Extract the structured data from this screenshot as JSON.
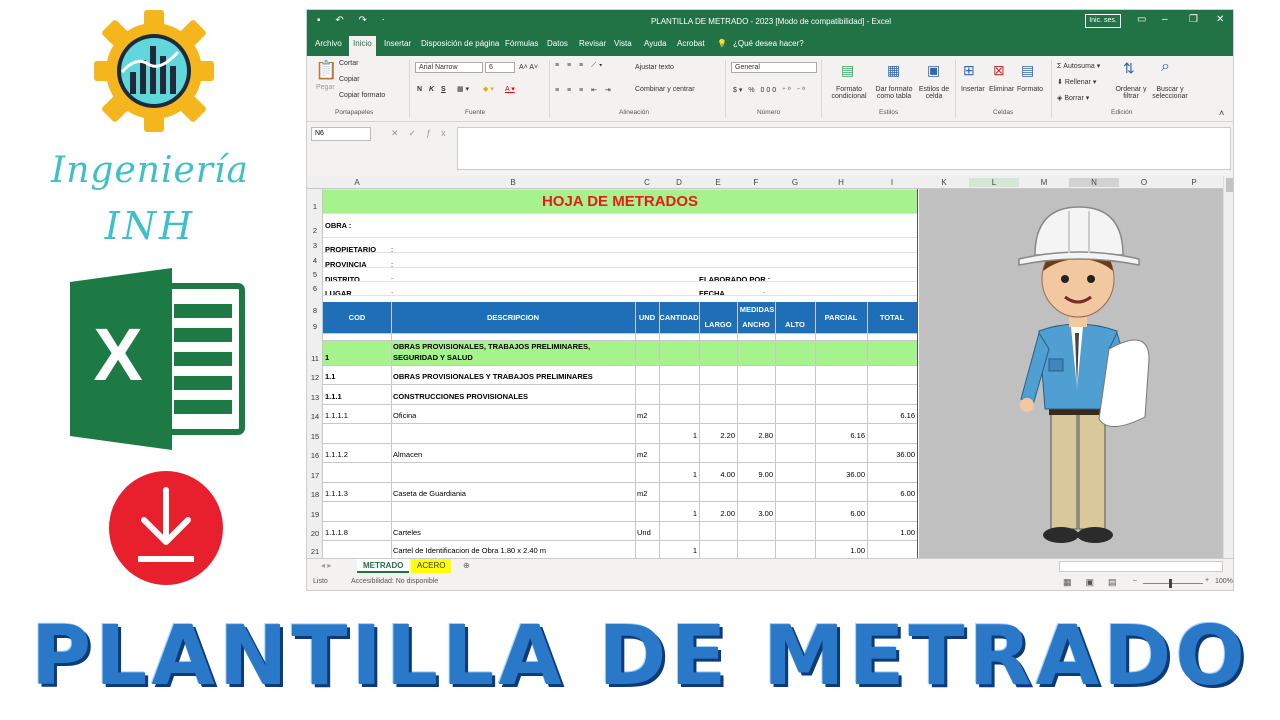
{
  "brand": {
    "line1": "Ingeniería",
    "line2": "INH",
    "gear_color": "#f5b61d",
    "accent": "#3fc0c8",
    "download_color": "#e8202e"
  },
  "banner": {
    "text": "PLANTILLA DE METRADO",
    "color": "#2a78c8"
  },
  "excel": {
    "title": "PLANTILLA DE METRADO - 2023  [Modo de compatibilidad]  -  Excel",
    "login_label": "Inic. ses.",
    "quick_access": "▪ ↶ ↷ ⋅",
    "tabs": [
      "Archivo",
      "Inicio",
      "Insertar",
      "Disposición de página",
      "Fórmulas",
      "Datos",
      "Revisar",
      "Vista",
      "Ayuda",
      "Acrobat"
    ],
    "active_tab": "Inicio",
    "tell_me": "¿Qué desea hacer?",
    "ribbon": {
      "cut": "Cortar",
      "copy": "Copiar",
      "format_painter": "Copiar formato",
      "paste": "Pegar",
      "font_name": "Arial Narrow",
      "font_size": "6",
      "bold": "N",
      "italic": "K",
      "underline": "S",
      "wrap": "Ajustar texto",
      "merge": "Combinar y centrar",
      "number_format": "General",
      "cond_format": "Formato condicional",
      "table_format": "Dar formato como tabla",
      "cell_styles": "Estilos de celda",
      "insert": "Insertar",
      "delete": "Eliminar",
      "format": "Formato",
      "autosum": "Autosuma",
      "fill": "Rellenar",
      "clear": "Borrar",
      "sort": "Ordenar y filtrar",
      "find": "Buscar y seleccionar",
      "groups": {
        "clipboard": "Portapapeles",
        "font": "Fuente",
        "alignment": "Alineación",
        "number": "Número",
        "styles": "Estilos",
        "cells": "Celdas",
        "editing": "Edición"
      }
    },
    "name_box": "N6",
    "columns": [
      "A",
      "B",
      "C",
      "D",
      "E",
      "F",
      "G",
      "H",
      "I",
      "K",
      "L",
      "M",
      "N",
      "O",
      "P"
    ],
    "sheet": {
      "title": "HOJA DE METRADOS",
      "obra_label": "OBRA  :",
      "propietario_label": "PROPIETARIO",
      "provincia_label": "PROVINCIA",
      "distrito_label": "DISTRITO",
      "lugar_label": "LUGAR",
      "colon": ":",
      "elaborado_label": "ELABORADO POR :",
      "fecha_label": "FECHA",
      "headers": {
        "cod": "COD",
        "descripcion": "DESCRIPCION",
        "und": "UND",
        "cantidad": "CANTIDAD",
        "medidas": "MEDIDAS",
        "largo": "LARGO",
        "ancho": "ANCHO",
        "alto": "ALTO",
        "parcial": "PARCIAL",
        "total": "TOTAL"
      },
      "row_numbers": [
        "1",
        "2",
        "3",
        "4",
        "5",
        "6",
        "8",
        "9",
        "11",
        "12",
        "13",
        "14",
        "15",
        "16",
        "17",
        "18",
        "19",
        "20",
        "21"
      ],
      "rows": [
        {
          "n": "11",
          "cod": "1",
          "desc": "OBRAS PROVISIONALES, TRABAJOS PRELIMINARES,",
          "desc2": "SEGURIDAD Y SALUD",
          "und": "",
          "cant": "",
          "largo": "",
          "ancho": "",
          "alto": "",
          "parcial": "",
          "total": ""
        },
        {
          "n": "12",
          "cod": "1.1",
          "desc": "OBRAS PROVISIONALES Y TRABAJOS PRELIMINARES",
          "desc2": "",
          "und": "",
          "cant": "",
          "largo": "",
          "ancho": "",
          "alto": "",
          "parcial": "",
          "total": ""
        },
        {
          "n": "13",
          "cod": "1.1.1",
          "desc": "CONSTRUCCIONES PROVISIONALES",
          "desc2": "",
          "und": "",
          "cant": "",
          "largo": "",
          "ancho": "",
          "alto": "",
          "parcial": "",
          "total": ""
        },
        {
          "n": "14",
          "cod": "1.1.1.1",
          "desc": "Oficina",
          "desc2": "",
          "und": "m2",
          "cant": "",
          "largo": "",
          "ancho": "",
          "alto": "",
          "parcial": "",
          "total": "6.16"
        },
        {
          "n": "15",
          "cod": "",
          "desc": "",
          "desc2": "",
          "und": "",
          "cant": "1",
          "largo": "2.20",
          "ancho": "2.80",
          "alto": "",
          "parcial": "6.16",
          "total": ""
        },
        {
          "n": "16",
          "cod": "1.1.1.2",
          "desc": "Almacen",
          "desc2": "",
          "und": "m2",
          "cant": "",
          "largo": "",
          "ancho": "",
          "alto": "",
          "parcial": "",
          "total": "36.00"
        },
        {
          "n": "17",
          "cod": "",
          "desc": "",
          "desc2": "",
          "und": "",
          "cant": "1",
          "largo": "4.00",
          "ancho": "9.00",
          "alto": "",
          "parcial": "36.00",
          "total": ""
        },
        {
          "n": "18",
          "cod": "1.1.1.3",
          "desc": "Caseta de Guardiania",
          "desc2": "",
          "und": "m2",
          "cant": "",
          "largo": "",
          "ancho": "",
          "alto": "",
          "parcial": "",
          "total": "6.00"
        },
        {
          "n": "19",
          "cod": "",
          "desc": "",
          "desc2": "",
          "und": "",
          "cant": "1",
          "largo": "2.00",
          "ancho": "3.00",
          "alto": "",
          "parcial": "6.00",
          "total": ""
        },
        {
          "n": "20",
          "cod": "1.1.1.8",
          "desc": "Carteles",
          "desc2": "",
          "und": "Und",
          "cant": "",
          "largo": "",
          "ancho": "",
          "alto": "",
          "parcial": "",
          "total": "1.00"
        },
        {
          "n": "21",
          "cod": "",
          "desc": "Cartel de Identificacion de Obra 1.80 x 2.40 m",
          "desc2": "",
          "und": "",
          "cant": "1",
          "largo": "",
          "ancho": "",
          "alto": "",
          "parcial": "1.00",
          "total": ""
        }
      ]
    },
    "sheet_tabs": [
      "METRADO",
      "ACERO"
    ],
    "status": {
      "ready": "Listo",
      "accessibility": "Accesibilidad: No disponible",
      "zoom": "100%"
    },
    "colors": {
      "title_bar": "#217346",
      "title_band": "#a6f28c",
      "header_band": "#1f6fb8",
      "title_text": "#e51c1c"
    }
  }
}
